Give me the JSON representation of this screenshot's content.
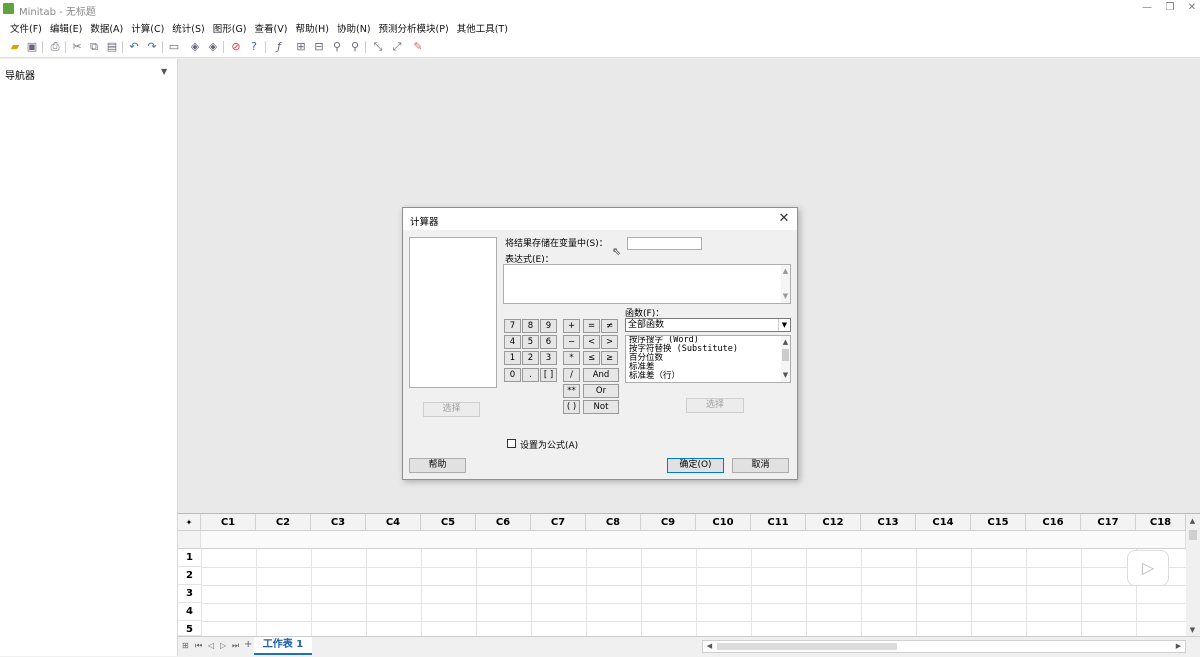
{
  "window": {
    "title": "Minitab - 无标题"
  },
  "menu": [
    "文件(F)",
    "编辑(E)",
    "数据(A)",
    "计算(C)",
    "统计(S)",
    "图形(G)",
    "查看(V)",
    "帮助(H)",
    "协助(N)",
    "预测分析模块(P)",
    "其他工具(T)"
  ],
  "navigator": {
    "title": "导航器"
  },
  "dialog": {
    "title": "计算器",
    "store_label": "将结果存储在变量中(S)：",
    "store_value": "",
    "expr_label": "表达式(E)：",
    "expr_value": "",
    "select_left": "选择",
    "select_right": "选择",
    "functions_label": "函数(F)：",
    "functions_selected": "全部函数",
    "functions_list": [
      "按序搜字 (Word)",
      "按字符替换 (Substitute)",
      "百分位数",
      "标准差",
      "标准差（行）"
    ],
    "keypad": {
      "r1": [
        "7",
        "8",
        "9",
        "+",
        "=",
        "≠"
      ],
      "r2": [
        "4",
        "5",
        "6",
        "−",
        "<",
        ">"
      ],
      "r3": [
        "1",
        "2",
        "3",
        "*",
        "≤",
        "≥"
      ],
      "r4": [
        "0",
        ".",
        "[ ]",
        "/",
        "And"
      ],
      "r5": [
        "**",
        "Or"
      ],
      "r6": [
        "( )",
        "Not"
      ]
    },
    "formula_checkbox": "设置为公式(A)",
    "help": "帮助",
    "ok": "确定(O)",
    "cancel": "取消"
  },
  "sheet": {
    "columns": [
      "C1",
      "C2",
      "C3",
      "C4",
      "C5",
      "C6",
      "C7",
      "C8",
      "C9",
      "C10",
      "C11",
      "C12",
      "C13",
      "C14",
      "C15",
      "C16",
      "C17",
      "C18"
    ],
    "rows": [
      "1",
      "2",
      "3",
      "4",
      "5"
    ],
    "tab": "工作表 1"
  }
}
